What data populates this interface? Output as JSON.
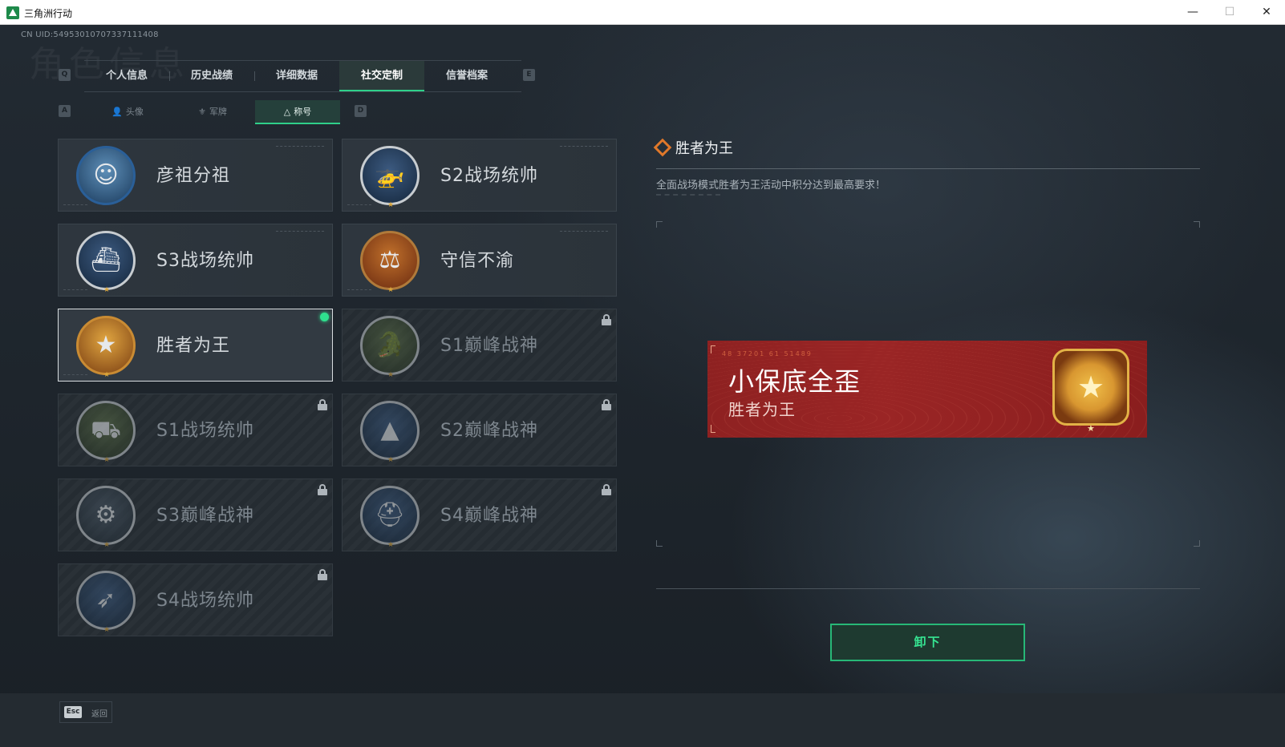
{
  "window": {
    "title": "三角洲行动",
    "min": "—",
    "max": "☐",
    "close": "✕"
  },
  "uid": "CN UID:54953010707337111408",
  "bg_title": "角色信息",
  "hints": {
    "prev_tab": "Q",
    "next_tab": "E",
    "prev_sub": "A",
    "next_sub": "D"
  },
  "tabs": [
    "个人信息",
    "历史战绩",
    "详细数据",
    "社交定制",
    "信誉档案"
  ],
  "active_tab": "社交定制",
  "subtabs": [
    {
      "icon": "person-icon",
      "glyph": "👤",
      "label": "头像"
    },
    {
      "icon": "military-rank-icon",
      "glyph": "⚜",
      "label": "军牌"
    },
    {
      "icon": "title-icon",
      "glyph": "△",
      "label": "称号"
    }
  ],
  "titles": [
    {
      "name": "彦祖分祖",
      "emblem": "portrait-emblem-icon",
      "glyph": "☺",
      "locked": false,
      "equipped": false
    },
    {
      "name": "S2战场统帅",
      "emblem": "helicopter-emblem-icon",
      "glyph": "🚁",
      "locked": false,
      "equipped": false
    },
    {
      "name": "S3战场统帅",
      "emblem": "hovercraft-emblem-icon",
      "glyph": "⛴",
      "locked": false,
      "equipped": false
    },
    {
      "name": "守信不渝",
      "emblem": "scales-emblem-icon",
      "glyph": "⚖",
      "locked": false,
      "equipped": false
    },
    {
      "name": "胜者为王",
      "emblem": "gold-medal-emblem-icon",
      "glyph": "★",
      "locked": false,
      "equipped": true
    },
    {
      "name": "S1巅峰战神",
      "emblem": "crocodile-emblem-icon",
      "glyph": "🐊",
      "locked": true,
      "equipped": false
    },
    {
      "name": "S1战场统帅",
      "emblem": "tank-emblem-icon",
      "glyph": "⛟",
      "locked": true,
      "equipped": false
    },
    {
      "name": "S2巅峰战神",
      "emblem": "triangle-emblem-icon",
      "glyph": "▲",
      "locked": true,
      "equipped": false
    },
    {
      "name": "S3巅峰战神",
      "emblem": "globe-emblem-icon",
      "glyph": "⚙",
      "locked": true,
      "equipped": false
    },
    {
      "name": "S4巅峰战神",
      "emblem": "helmet-emblem-icon",
      "glyph": "⛑",
      "locked": true,
      "equipped": false
    },
    {
      "name": "S4战场统帅",
      "emblem": "missile-emblem-icon",
      "glyph": "➶",
      "locked": true,
      "equipped": false
    }
  ],
  "detail": {
    "title": "胜者为王",
    "description": "全面战场模式胜者为王活动中积分达到最高要求！"
  },
  "banner": {
    "code": "48 37201 61 51489",
    "nickname": "小保底全歪",
    "subtitle": "胜者为王",
    "medal_icon": "gold-medal-emblem-icon"
  },
  "unequip_label": "卸下",
  "footer": {
    "esc_key": "Esc",
    "esc_label": "返回"
  },
  "colors": {
    "accent": "#2fd08a",
    "banner_red": "#9a2525",
    "gold": "#d89630"
  }
}
